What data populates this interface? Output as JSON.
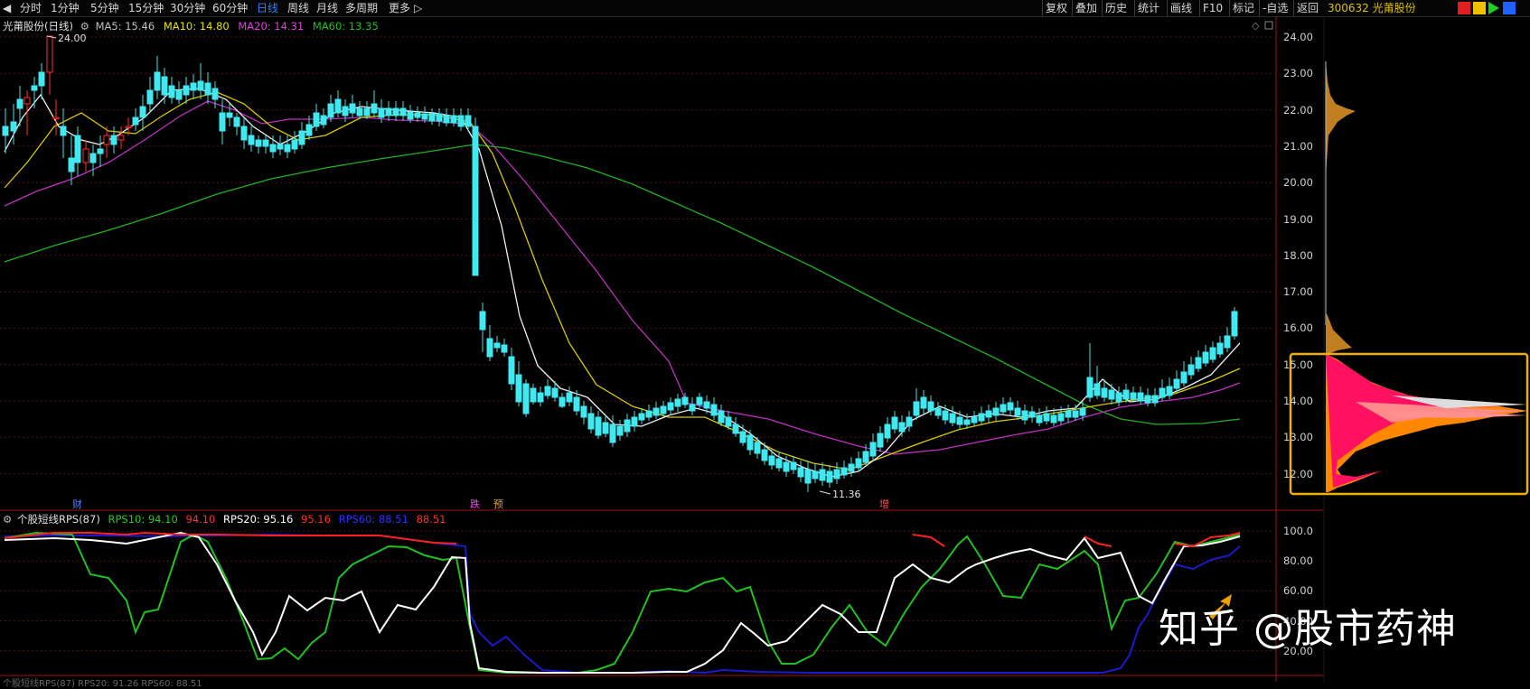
{
  "toolbar": {
    "tabs": [
      {
        "label": "分时",
        "x": 22
      },
      {
        "label": "1分钟",
        "x": 56
      },
      {
        "label": "5分钟",
        "x": 100
      },
      {
        "label": "15分钟",
        "x": 142
      },
      {
        "label": "30分钟",
        "x": 188
      },
      {
        "label": "60分钟",
        "x": 235
      },
      {
        "label": "日线",
        "x": 284
      },
      {
        "label": "周线",
        "x": 318
      },
      {
        "label": "月线",
        "x": 350
      },
      {
        "label": "多周期",
        "x": 382
      },
      {
        "label": "更多",
        "x": 430
      }
    ],
    "more_arrow": "▷",
    "right_buttons": [
      "复权",
      "叠加",
      "历史",
      "统计",
      "画线",
      "F10",
      "标记",
      "-自选",
      "返回"
    ],
    "stock_code": "300632 光莆股份"
  },
  "main_chart": {
    "title": "光莆股份(日线)",
    "ma_labels": [
      {
        "text": "MA5: 15.46",
        "color": "#ffffff"
      },
      {
        "text": "MA10: 14.80",
        "color": "#e8e000"
      },
      {
        "text": "MA20: 14.31",
        "color": "#e040e0"
      },
      {
        "text": "MA60: 13.35",
        "color": "#20c020"
      }
    ],
    "high_label": "24.00",
    "low_label": "11.36",
    "y_ticks": [
      "24.00",
      "23.00",
      "22.00",
      "21.00",
      "20.00",
      "19.00",
      "18.00",
      "17.00",
      "16.00",
      "15.00",
      "14.00",
      "13.00",
      "12.00"
    ],
    "event_markers": [
      {
        "text": "财",
        "color": "#5080ff"
      },
      {
        "text": "跌",
        "color": "#ff40ff"
      },
      {
        "text": "预",
        "color": "#e8a040"
      },
      {
        "text": "增",
        "color": "#ff5050"
      }
    ]
  },
  "indicator": {
    "title": "个股短线RPS(87)",
    "labels": [
      {
        "text": "RPS10: 94.10",
        "color": "#20d020"
      },
      {
        "text": "94.10",
        "color": "#ff3030"
      },
      {
        "text": "RPS20: 95.16",
        "color": "#ffffff"
      },
      {
        "text": "95.16",
        "color": "#ff3030"
      },
      {
        "text": "RPS60: 88.51",
        "color": "#3030ff"
      },
      {
        "text": "88.51",
        "color": "#ff3030"
      }
    ],
    "y_ticks": [
      "100.0",
      "80.00",
      "60.00",
      "40.00",
      "20.00"
    ]
  },
  "bottom_hint": "个股短线RPS(87)   RPS20: 91.26   RPS60: 88.51",
  "watermark": "知乎 @股市药神"
}
